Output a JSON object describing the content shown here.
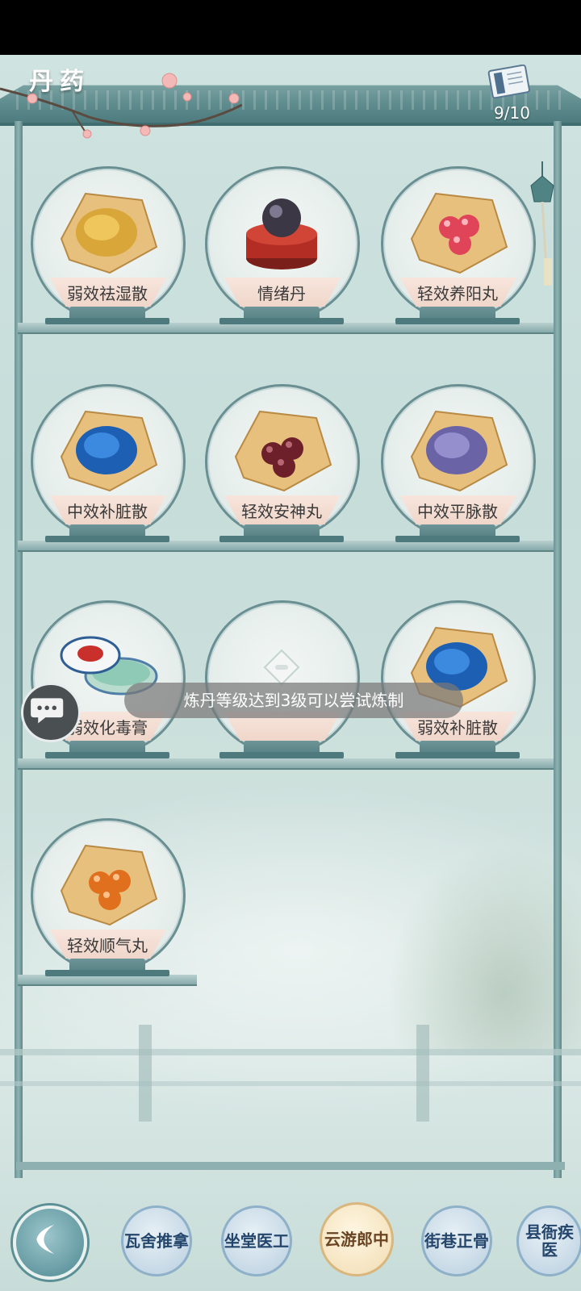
{
  "header": {
    "title": "丹药",
    "counter": "9/10"
  },
  "medicines": [
    {
      "name": "弱效祛湿散",
      "art": "yellow-powder"
    },
    {
      "name": "情绪丹",
      "art": "dark-pill-box"
    },
    {
      "name": "轻效养阳丸",
      "art": "red-pills"
    },
    {
      "name": "中效补脏散",
      "art": "blue-powder"
    },
    {
      "name": "轻效安神丸",
      "art": "dark-red-pills"
    },
    {
      "name": "中效平脉散",
      "art": "purple-powder"
    },
    {
      "name": "弱效化毒膏",
      "art": "ointment-jar"
    },
    {
      "name": "",
      "art": "locked"
    },
    {
      "name": "弱效补脏散",
      "art": "blue-powder"
    },
    {
      "name": "轻效顺气丸",
      "art": "orange-pills"
    }
  ],
  "toast": "炼丹等级达到3级可以尝试炼制",
  "nav": {
    "items": [
      {
        "label": "瓦舍推拿"
      },
      {
        "label": "坐堂医工"
      },
      {
        "label": "云游郎中"
      },
      {
        "label": "街巷正骨"
      },
      {
        "label": "县衙疾医"
      }
    ],
    "active_index": 2
  },
  "colors": {
    "frame": "#5f8c8e",
    "plate_band": "#f0d6ca",
    "nav_active": "#f1dcb2"
  }
}
